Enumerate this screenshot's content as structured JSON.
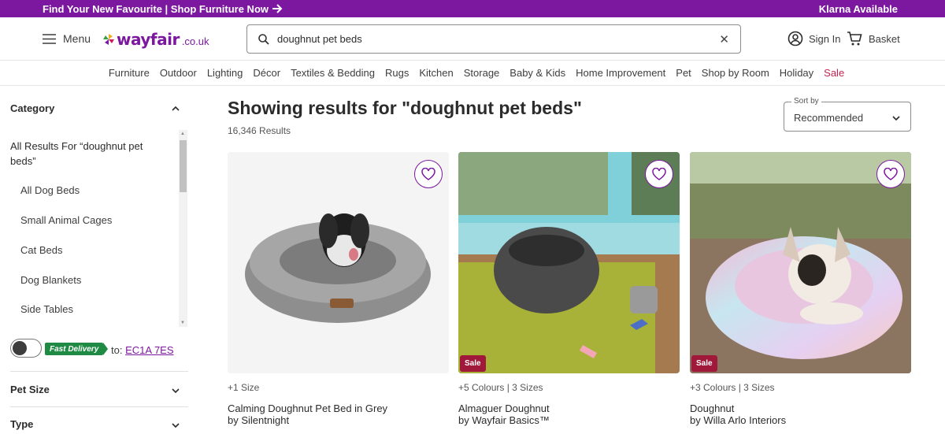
{
  "promo": {
    "left_text": "Find Your New Favourite | Shop Furniture Now",
    "right_text": "Klarna Available"
  },
  "header": {
    "menu_label": "Menu",
    "logo_word": "wayfair",
    "logo_tld": ".co.uk",
    "search_value": "doughnut pet beds",
    "sign_in_label": "Sign In",
    "basket_label": "Basket"
  },
  "nav": [
    "Furniture",
    "Outdoor",
    "Lighting",
    "Décor",
    "Textiles & Bedding",
    "Rugs",
    "Kitchen",
    "Storage",
    "Baby & Kids",
    "Home Improvement",
    "Pet",
    "Shop by Room",
    "Holiday",
    "Sale"
  ],
  "sidebar": {
    "category_heading": "Category",
    "all_results": "All Results For “doughnut pet beds”",
    "categories": [
      "All Dog Beds",
      "Small Animal Cages",
      "Cat Beds",
      "Dog Blankets",
      "Side Tables"
    ],
    "fast_delivery_label": "Fast Delivery",
    "to_label": "to:",
    "postcode": "EC1A 7ES",
    "pet_size_heading": "Pet Size",
    "type_heading": "Type"
  },
  "results": {
    "title": "Showing results for \"doughnut pet beds\"",
    "count": "16,346 Results",
    "sort_label": "Sort by",
    "sort_value": "Recommended"
  },
  "products": [
    {
      "variants": "+1 Size",
      "name": "Calming Doughnut Pet Bed in Grey",
      "brand": "by Silentnight",
      "sale": ""
    },
    {
      "variants": "+5 Colours | 3 Sizes",
      "name": "Almaguer Doughnut",
      "brand": "by Wayfair Basics™",
      "sale": "Sale"
    },
    {
      "variants": "+3 Colours | 3 Sizes",
      "name": "Doughnut",
      "brand": "by Willa Arlo Interiors",
      "sale": "Sale"
    }
  ],
  "colors": {
    "brand": "#7b189f",
    "sale": "#c3244e",
    "fast_delivery": "#1e8a44"
  }
}
